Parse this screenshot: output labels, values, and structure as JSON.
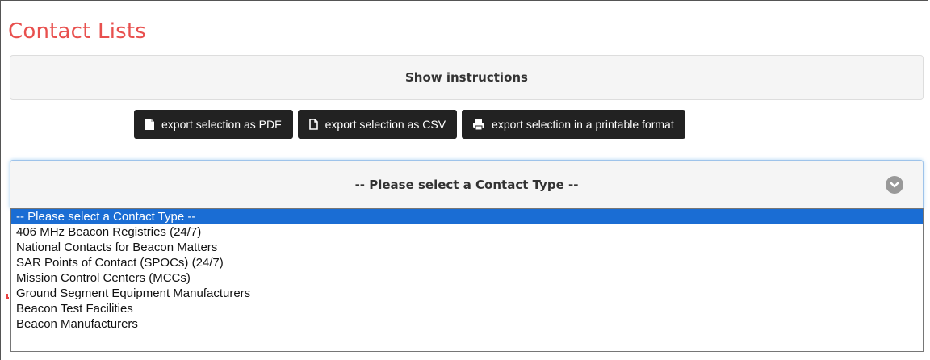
{
  "page": {
    "title": "Contact Lists",
    "instructions_label": "Show instructions"
  },
  "export": {
    "pdf_label": "export selection as PDF",
    "csv_label": "export selection as CSV",
    "print_label": "export selection in a printable format",
    "pdf_icon": "file-icon",
    "csv_icon": "file-outline-icon",
    "print_icon": "printer-icon"
  },
  "contact_type": {
    "selected_label": "-- Please select a Contact Type --",
    "options": [
      "-- Please select a Contact Type --",
      "406 MHz Beacon Registries (24/7)",
      "National Contacts for Beacon Matters",
      "SAR Points of Contact (SPOCs) (24/7)",
      "Mission Control Centers (MCCs)",
      "Ground Segment Equipment Manufacturers",
      "Beacon Test Facilities",
      "Beacon Manufacturers"
    ],
    "highlighted_index": 0
  },
  "colors": {
    "title": "#e8504e",
    "button_bg": "#222222",
    "highlight": "#1a6dd4"
  }
}
